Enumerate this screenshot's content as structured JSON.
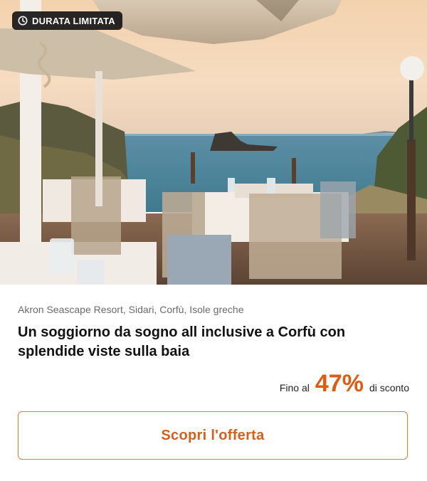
{
  "badge": {
    "label": "DURATA LIMITATA",
    "icon": "clock-icon"
  },
  "hero": {
    "image_subject": "restaurant-terrace-sea-view"
  },
  "offer": {
    "location": "Akron Seascape Resort, Sidari, Corfù, Isole greche",
    "title": "Un soggiorno da sogno all inclusive a Corfù con splendide viste sulla baia",
    "discount_prefix": "Fino al",
    "discount_value": "47%",
    "discount_suffix": "di sconto",
    "cta_label": "Scopri l'offerta"
  },
  "colors": {
    "accent": "#e05a12",
    "cta_border": "#e6793c",
    "badge_bg": "#161616"
  }
}
